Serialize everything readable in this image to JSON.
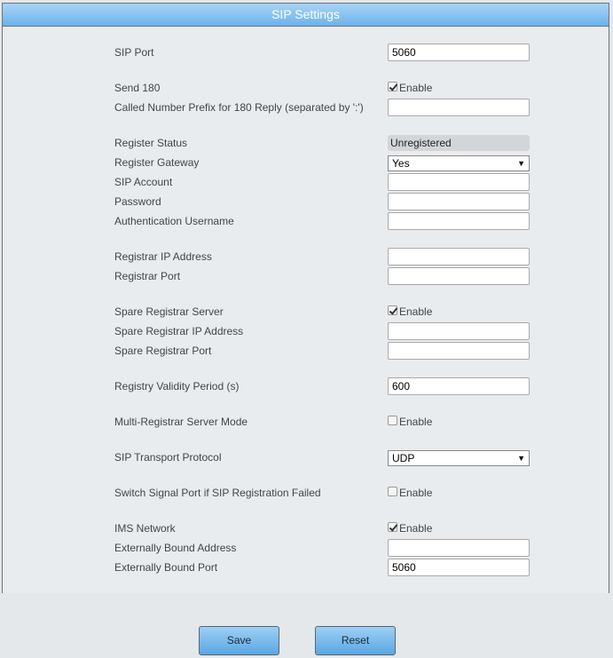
{
  "panel": {
    "title": "SIP Settings"
  },
  "fields": {
    "sip_port": {
      "label": "SIP Port",
      "value": "5060"
    },
    "send_180": {
      "label": "Send 180",
      "checked": true,
      "option": "Enable"
    },
    "called_prefix": {
      "label": "Called Number Prefix for 180 Reply (separated by ':')",
      "value": ""
    },
    "register_status": {
      "label": "Register Status",
      "value": "Unregistered"
    },
    "register_gateway": {
      "label": "Register Gateway",
      "value": "Yes"
    },
    "sip_account": {
      "label": "SIP Account",
      "value": ""
    },
    "password": {
      "label": "Password",
      "value": ""
    },
    "auth_username": {
      "label": "Authentication Username",
      "value": ""
    },
    "registrar_ip": {
      "label": "Registrar IP Address",
      "value": ""
    },
    "registrar_port": {
      "label": "Registrar Port",
      "value": ""
    },
    "spare_registrar_server": {
      "label": "Spare Registrar Server",
      "checked": true,
      "option": "Enable"
    },
    "spare_registrar_ip": {
      "label": "Spare Registrar IP Address",
      "value": ""
    },
    "spare_registrar_port": {
      "label": "Spare Registrar Port",
      "value": ""
    },
    "registry_validity": {
      "label": "Registry Validity Period (s)",
      "value": "600"
    },
    "multi_registrar_mode": {
      "label": "Multi-Registrar Server Mode",
      "checked": false,
      "option": "Enable"
    },
    "transport_protocol": {
      "label": "SIP Transport Protocol",
      "value": "UDP"
    },
    "switch_signal_port": {
      "label": "Switch Signal Port if SIP Registration Failed",
      "checked": false,
      "option": "Enable"
    },
    "ims_network": {
      "label": "IMS Network",
      "checked": true,
      "option": "Enable"
    },
    "ext_bound_address": {
      "label": "Externally Bound Address",
      "value": ""
    },
    "ext_bound_port": {
      "label": "Externally Bound Port",
      "value": "5060"
    }
  },
  "buttons": {
    "save": "Save",
    "reset": "Reset"
  }
}
